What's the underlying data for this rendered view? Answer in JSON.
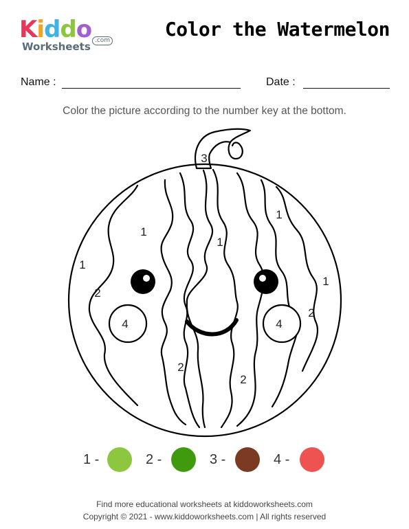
{
  "logo": {
    "letters": [
      {
        "char": "K",
        "color": "#e8375b"
      },
      {
        "char": "i",
        "color": "#f6a21a"
      },
      {
        "char": "d",
        "color": "#3fb3e3"
      },
      {
        "char": "d",
        "color": "#8cc63e"
      },
      {
        "char": "o",
        "color": "#a35fd0"
      }
    ],
    "subtitle": "Worksheets",
    "domain": ".com"
  },
  "title": "Color the Watermelon",
  "form": {
    "name_label": "Name :",
    "date_label": "Date :"
  },
  "instructions": "Color the picture according to the number key at the bottom.",
  "picture": {
    "region_numbers": [
      "3",
      "1",
      "1",
      "1",
      "1",
      "1",
      "2",
      "2",
      "2",
      "2",
      "4",
      "4"
    ]
  },
  "color_key": [
    {
      "label": "1 -",
      "color": "#8dc63f"
    },
    {
      "label": "2 -",
      "color": "#3f9a0e"
    },
    {
      "label": "3 -",
      "color": "#7a3b22"
    },
    {
      "label": "4 -",
      "color": "#ee5352"
    }
  ],
  "footer": {
    "line1": "Find more educational worksheets at kiddoworksheets.com",
    "line2": "Copyright © 2021 - www.kiddoworksheets.com  |  All rights reserved"
  }
}
